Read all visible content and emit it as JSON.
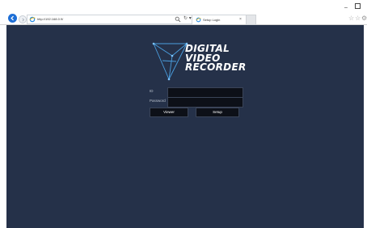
{
  "browser": {
    "address": "http://192.168.0.9/",
    "tab_title": "Setup Login",
    "tab_close": "×",
    "refresh_glyph": "↻ ▾",
    "minimize": "–",
    "icons": {
      "back": "back-arrow-icon",
      "forward": "forward-arrow-icon",
      "search": "search-icon",
      "home": "home-icon",
      "favorites": "star-icon",
      "settings": "gear-icon"
    }
  },
  "logo": {
    "line1": "DIGITAL",
    "line2": "VIDEO",
    "line3": "RECORDER"
  },
  "login": {
    "id_label": "ID",
    "id_value": "",
    "password_label": "Password",
    "password_value": "",
    "viewer_label": "Viewer",
    "setup_label": "Setup"
  },
  "colors": {
    "page_background": "#253149",
    "field_background": "#0d1018",
    "accent": "#1e6fd6"
  }
}
